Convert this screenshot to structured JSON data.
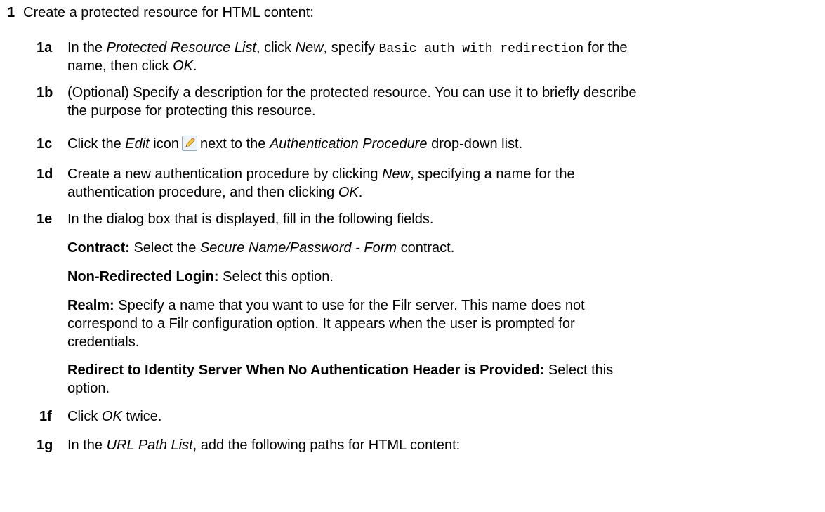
{
  "step1": {
    "num": "1",
    "text": "Create a protected resource for HTML content:"
  },
  "step1a": {
    "num": "1a",
    "t1": "In the ",
    "e1": "Protected Resource List",
    "t2": ", click ",
    "e2": "New",
    "t3": ", specify ",
    "code": "Basic auth with redirection",
    "t4": " for the",
    "line2a": "name, then click ",
    "line2e": "OK",
    "line2b": "."
  },
  "step1b": {
    "num": "1b",
    "line1": "(Optional) Specify a description for the protected resource. You can use it to briefly describe",
    "line2": "the purpose for protecting this resource."
  },
  "step1c": {
    "num": "1c",
    "t1": "Click the ",
    "e1": "Edit",
    "t2": " icon",
    "t3": "next to the ",
    "e2": "Authentication Procedure",
    "t4": " drop-down list.",
    "icon": "pencil-edit-icon"
  },
  "step1d": {
    "num": "1d",
    "t1": "Create a new authentication procedure by clicking ",
    "e1": "New",
    "t2": ", specifying a name for the",
    "line2a": "authentication procedure, and then clicking ",
    "line2e": "OK",
    "line2b": "."
  },
  "step1e": {
    "num": "1e",
    "text": "In the dialog box that is displayed, fill in the following fields.",
    "contract_label": "Contract:",
    "contract_t1": " Select the ",
    "contract_e1": "Secure Name/Password - Form",
    "contract_t2": " contract.",
    "nonredirect_label": "Non-Redirected Login:",
    "nonredirect_text": " Select this option.",
    "realm_label": "Realm:",
    "realm_line1": " Specify a name that you want to use for the Filr server. This name does not",
    "realm_line2": "correspond to a Filr configuration option. It appears when the user is prompted for",
    "realm_line3": "credentials.",
    "redirect_label": "Redirect to Identity Server When No Authentication Header is Provided:",
    "redirect_text1": " Select this",
    "redirect_text2": "option."
  },
  "step1f": {
    "num": "1f",
    "t1": "Click ",
    "e1": "OK",
    "t2": " twice."
  },
  "step1g": {
    "num": "1g",
    "t1": "In the ",
    "e1": "URL Path List",
    "t2": ", add the following paths for HTML content:"
  }
}
